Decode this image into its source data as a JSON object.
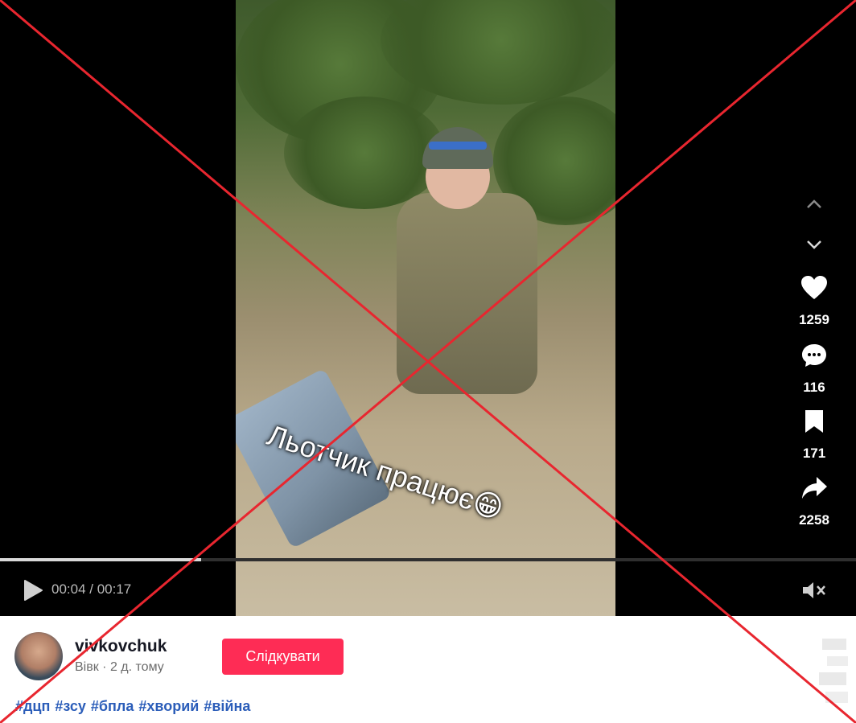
{
  "player": {
    "caption": "Льотчик працює😁",
    "time": "00:04 / 00:17",
    "progress": 0.235,
    "progress_color": "#d9d9d9"
  },
  "side_actions": {
    "prev_icon": "chevron-up-icon",
    "next_icon": "chevron-down-icon",
    "likes": "1259",
    "comments": "116",
    "saves": "171",
    "shares": "2258"
  },
  "author": {
    "username": "vivkovchuk",
    "meta": "Вівк · 2 д. тому",
    "follow_label": "Слідкувати",
    "follow_color": "#fe2c55"
  },
  "hashtags": [
    "#дцп",
    "#зсу",
    "#бпла",
    "#хворий",
    "#війна"
  ],
  "overlay": {
    "cross_color": "#e8262f"
  }
}
